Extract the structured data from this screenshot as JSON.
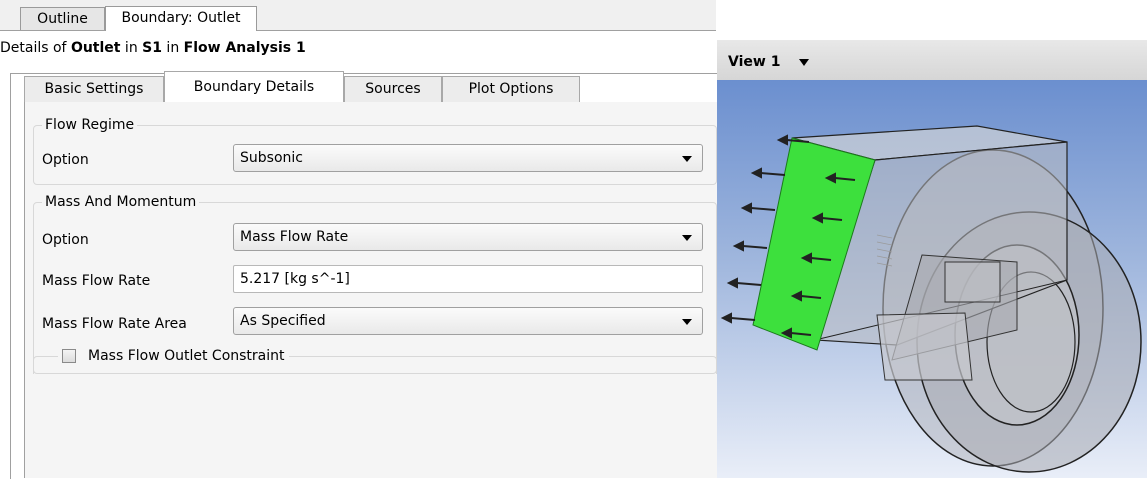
{
  "tabs": {
    "outline": "Outline",
    "boundary": "Boundary: Outlet"
  },
  "details": {
    "prefix": "Details of ",
    "object": "Outlet",
    "in1": " in ",
    "domain": "S1",
    "in2": " in ",
    "analysis": "Flow Analysis 1"
  },
  "subtabs": {
    "basic": "Basic Settings",
    "boundary_details": "Boundary Details",
    "sources": "Sources",
    "plot_options": "Plot Options"
  },
  "flow_regime": {
    "group_label": "Flow Regime",
    "option_label": "Option",
    "option_value": "Subsonic"
  },
  "mass_momentum": {
    "group_label": "Mass And Momentum",
    "option_label": "Option",
    "option_value": "Mass Flow Rate",
    "rate_label": "Mass Flow Rate",
    "rate_value": "5.217 [kg s^-1]",
    "area_label": "Mass Flow Rate Area",
    "area_value": "As Specified",
    "constraint_label": "Mass Flow Outlet Constraint",
    "constraint_checked": false
  },
  "view": {
    "title": "View 1"
  },
  "colors": {
    "outlet_face": "#3de03d",
    "viewport_top": "#6b8fcf",
    "viewport_bottom": "#e9eef8"
  }
}
